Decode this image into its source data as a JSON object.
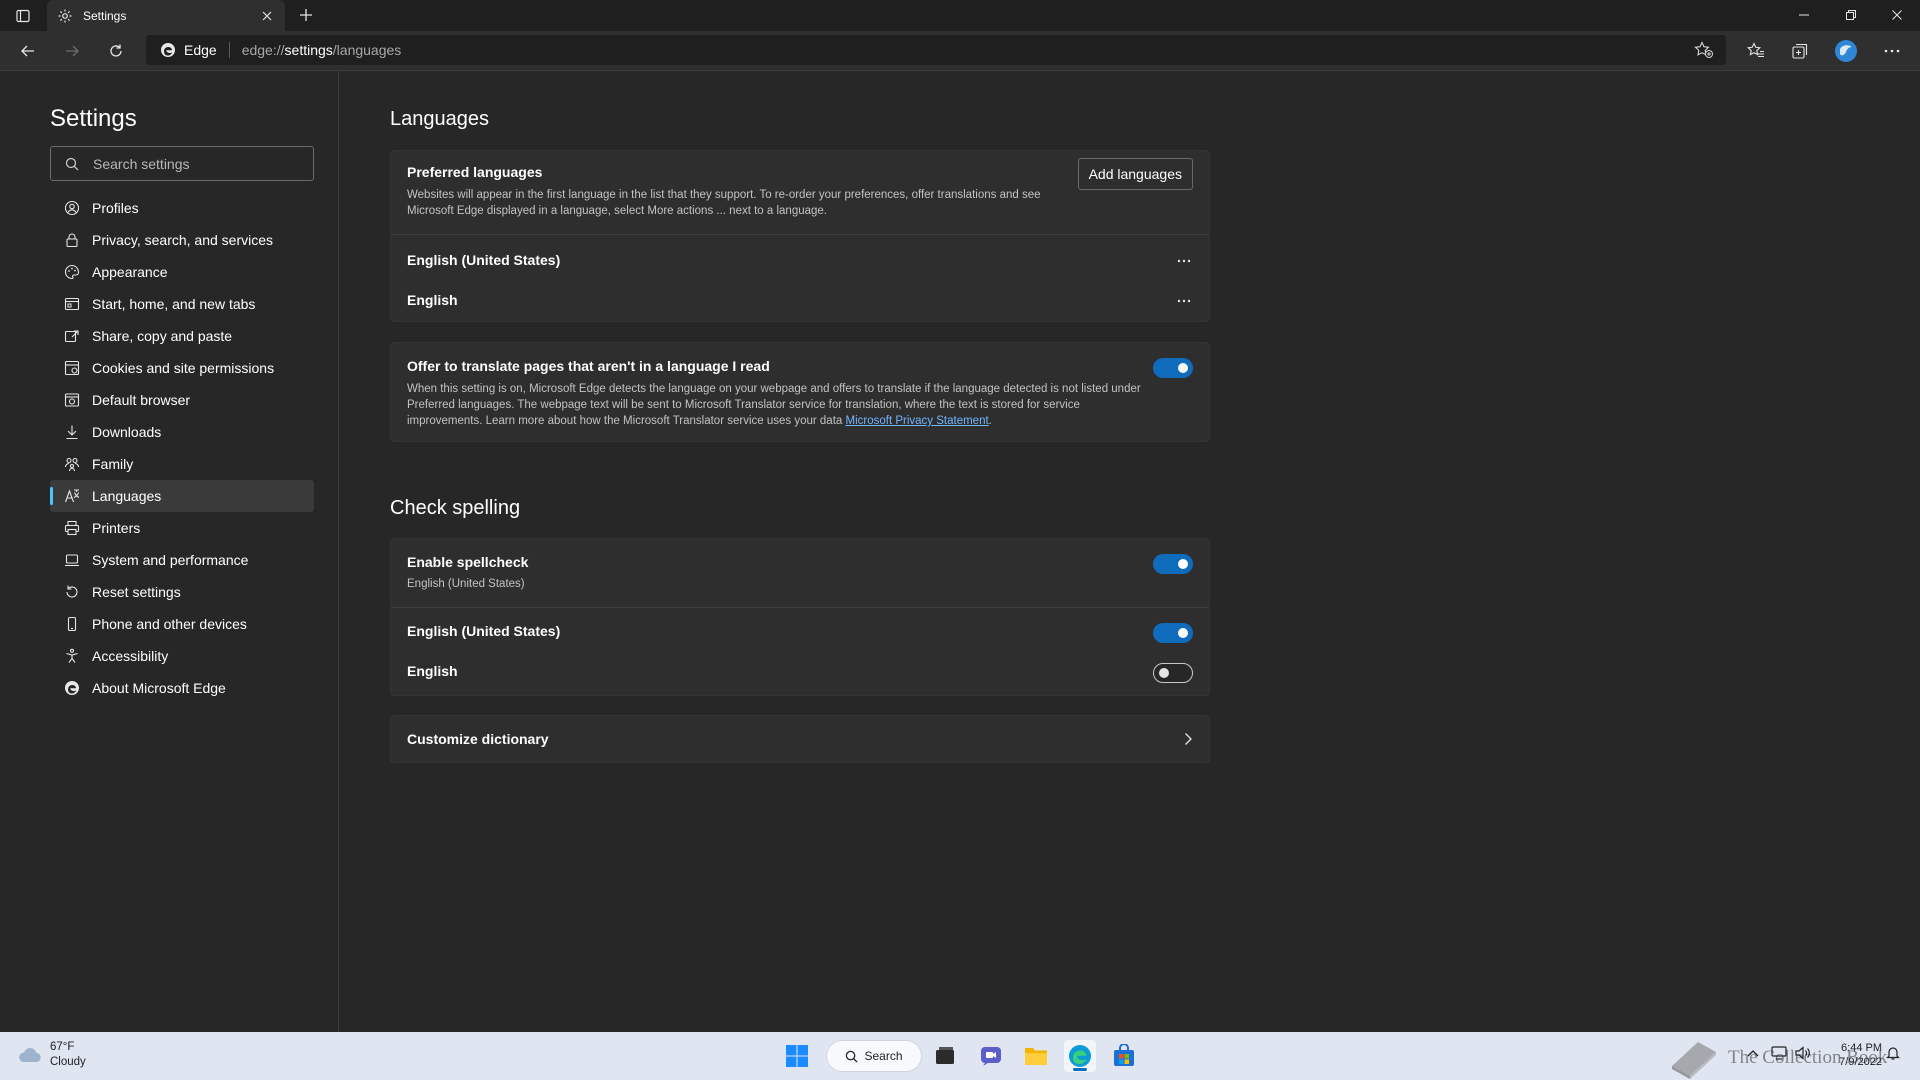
{
  "browser": {
    "tab_title": "Settings",
    "address_badge": "Edge",
    "url_prefix": "edge://",
    "url_host": "settings",
    "url_path": "/languages"
  },
  "sidebar": {
    "title": "Settings",
    "search_placeholder": "Search settings",
    "items": [
      {
        "label": "Profiles",
        "icon": "profile-icon"
      },
      {
        "label": "Privacy, search, and services",
        "icon": "lock-icon"
      },
      {
        "label": "Appearance",
        "icon": "palette-icon"
      },
      {
        "label": "Start, home, and new tabs",
        "icon": "window-icon"
      },
      {
        "label": "Share, copy and paste",
        "icon": "share-icon"
      },
      {
        "label": "Cookies and site permissions",
        "icon": "cookie-permissions-icon"
      },
      {
        "label": "Default browser",
        "icon": "browser-icon"
      },
      {
        "label": "Downloads",
        "icon": "download-icon"
      },
      {
        "label": "Family",
        "icon": "family-icon"
      },
      {
        "label": "Languages",
        "icon": "languages-icon",
        "active": true
      },
      {
        "label": "Printers",
        "icon": "printer-icon"
      },
      {
        "label": "System and performance",
        "icon": "laptop-icon"
      },
      {
        "label": "Reset settings",
        "icon": "reset-icon"
      },
      {
        "label": "Phone and other devices",
        "icon": "phone-icon"
      },
      {
        "label": "Accessibility",
        "icon": "accessibility-icon"
      },
      {
        "label": "About Microsoft Edge",
        "icon": "edge-logo-icon"
      }
    ]
  },
  "languages": {
    "heading": "Languages",
    "preferred": {
      "title": "Preferred languages",
      "description": "Websites will appear in the first language in the list that they support. To re-order your preferences, offer translations and see Microsoft Edge displayed in a language, select More actions ... next to a language.",
      "add_button": "Add languages",
      "items": [
        "English (United States)",
        "English"
      ]
    },
    "translate": {
      "title": "Offer to translate pages that aren't in a language I read",
      "description": "When this setting is on, Microsoft Edge detects the language on your webpage and offers to translate if the language detected is not listed under Preferred languages. The webpage text will be sent to Microsoft Translator service for translation, where the text is stored for service improvements. Learn more about how the Microsoft Translator service uses your data",
      "link": "Microsoft Privacy Statement",
      "link_suffix": ".",
      "enabled": true
    }
  },
  "spelling": {
    "heading": "Check spelling",
    "enable_title": "Enable spellcheck",
    "enable_subtitle": "English (United States)",
    "enable_on": true,
    "languages": [
      {
        "label": "English (United States)",
        "on": true
      },
      {
        "label": "English",
        "on": false
      }
    ],
    "customize": "Customize dictionary"
  },
  "taskbar": {
    "weather_temp": "67°F",
    "weather_desc": "Cloudy",
    "search_label": "Search",
    "time": "6:44 PM",
    "date": "7/9/2022",
    "watermark": "The Collection Book"
  },
  "colors": {
    "accent": "#0f6cbd",
    "active_indicator": "#4cc2ff",
    "background": "#272727",
    "card": "#2e2e2e"
  }
}
